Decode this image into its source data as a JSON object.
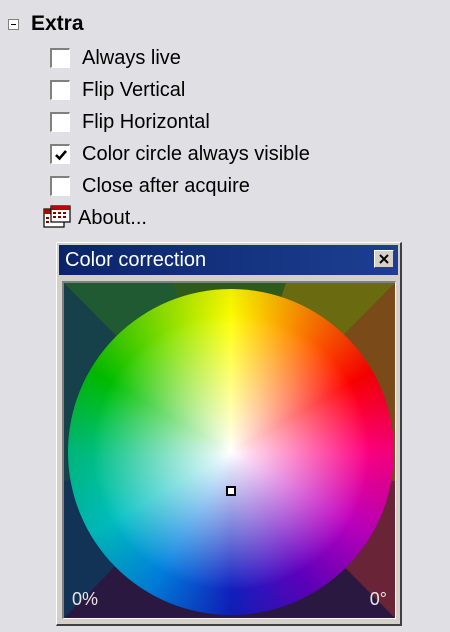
{
  "section": {
    "title": "Extra"
  },
  "options": [
    {
      "label": "Always live",
      "checked": false
    },
    {
      "label": "Flip Vertical",
      "checked": false
    },
    {
      "label": "Flip Horizontal",
      "checked": false
    },
    {
      "label": "Color circle always visible",
      "checked": true
    },
    {
      "label": "Close after acquire",
      "checked": false
    }
  ],
  "about": {
    "label": "About...",
    "icon": "calendar-icon"
  },
  "color_window": {
    "title": "Color correction",
    "saturation_readout": "0%",
    "hue_readout": "0°"
  },
  "colors": {
    "titlebar": "#0a246a",
    "panel_bg": "#d4d0c8",
    "page_bg": "#e0dfe3"
  }
}
